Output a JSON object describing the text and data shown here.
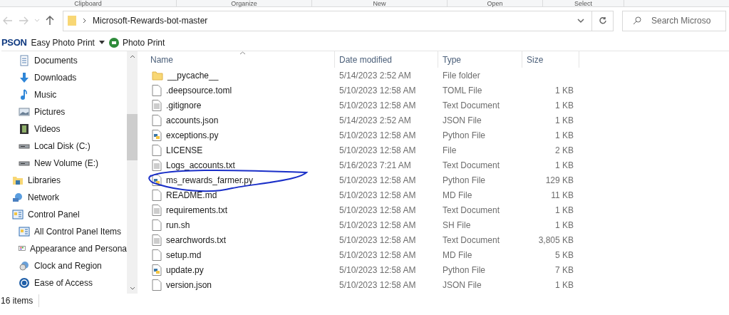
{
  "ribbon_groups": [
    "Clipboard",
    "Organize",
    "New",
    "Open",
    "Select"
  ],
  "address_bar": {
    "path": "Microsoft-Rewards-bot-master"
  },
  "search": {
    "placeholder": "Search Microso"
  },
  "epson_toolbar": {
    "logo": "PSON",
    "menu": "Easy Photo Print",
    "button": "Photo Print"
  },
  "sidebar": {
    "nested_items": [
      {
        "label": "Documents",
        "kind": "documents"
      },
      {
        "label": "Downloads",
        "kind": "downloads"
      },
      {
        "label": "Music",
        "kind": "music"
      },
      {
        "label": "Pictures",
        "kind": "pictures"
      },
      {
        "label": "Videos",
        "kind": "videos"
      },
      {
        "label": "Local Disk (C:)",
        "kind": "drive"
      },
      {
        "label": "New Volume (E:)",
        "kind": "drive"
      }
    ],
    "items": [
      {
        "label": "Libraries",
        "kind": "libraries"
      },
      {
        "label": "Network",
        "kind": "network"
      },
      {
        "label": "Control Panel",
        "kind": "control",
        "children": [
          {
            "label": "All Control Panel Items",
            "kind": "control"
          },
          {
            "label": "Appearance and Persona",
            "kind": "appearance"
          },
          {
            "label": "Clock and Region",
            "kind": "clock"
          },
          {
            "label": "Ease of Access",
            "kind": "access"
          }
        ]
      }
    ]
  },
  "table": {
    "columns": [
      "Name",
      "Date modified",
      "Type",
      "Size"
    ],
    "rows": [
      {
        "name": "__pycache__",
        "date": "5/14/2023 2:52 AM",
        "type": "File folder",
        "size": "",
        "kind": "folder"
      },
      {
        "name": ".deepsource.toml",
        "date": "5/10/2023 12:58 AM",
        "type": "TOML File",
        "size": "1 KB",
        "kind": "file"
      },
      {
        "name": ".gitignore",
        "date": "5/10/2023 12:58 AM",
        "type": "Text Document",
        "size": "1 KB",
        "kind": "text"
      },
      {
        "name": "accounts.json",
        "date": "5/14/2023 2:52 AM",
        "type": "JSON File",
        "size": "1 KB",
        "kind": "file"
      },
      {
        "name": "exceptions.py",
        "date": "5/10/2023 12:58 AM",
        "type": "Python File",
        "size": "1 KB",
        "kind": "python"
      },
      {
        "name": "LICENSE",
        "date": "5/10/2023 12:58 AM",
        "type": "File",
        "size": "2 KB",
        "kind": "file"
      },
      {
        "name": "Logs_accounts.txt",
        "date": "5/16/2023 7:21 AM",
        "type": "Text Document",
        "size": "1 KB",
        "kind": "text"
      },
      {
        "name": "ms_rewards_farmer.py",
        "date": "5/10/2023 12:58 AM",
        "type": "Python File",
        "size": "129 KB",
        "kind": "python"
      },
      {
        "name": "README.md",
        "date": "5/10/2023 12:58 AM",
        "type": "MD File",
        "size": "11 KB",
        "kind": "file"
      },
      {
        "name": "requirements.txt",
        "date": "5/10/2023 12:58 AM",
        "type": "Text Document",
        "size": "1 KB",
        "kind": "text"
      },
      {
        "name": "run.sh",
        "date": "5/10/2023 12:58 AM",
        "type": "SH File",
        "size": "1 KB",
        "kind": "file"
      },
      {
        "name": "searchwords.txt",
        "date": "5/10/2023 12:58 AM",
        "type": "Text Document",
        "size": "3,805 KB",
        "kind": "text"
      },
      {
        "name": "setup.md",
        "date": "5/10/2023 12:58 AM",
        "type": "MD File",
        "size": "5 KB",
        "kind": "file"
      },
      {
        "name": "update.py",
        "date": "5/10/2023 12:58 AM",
        "type": "Python File",
        "size": "7 KB",
        "kind": "python"
      },
      {
        "name": "version.json",
        "date": "5/10/2023 12:58 AM",
        "type": "JSON File",
        "size": "1 KB",
        "kind": "file"
      }
    ]
  },
  "status_bar": {
    "count": "16 items"
  }
}
